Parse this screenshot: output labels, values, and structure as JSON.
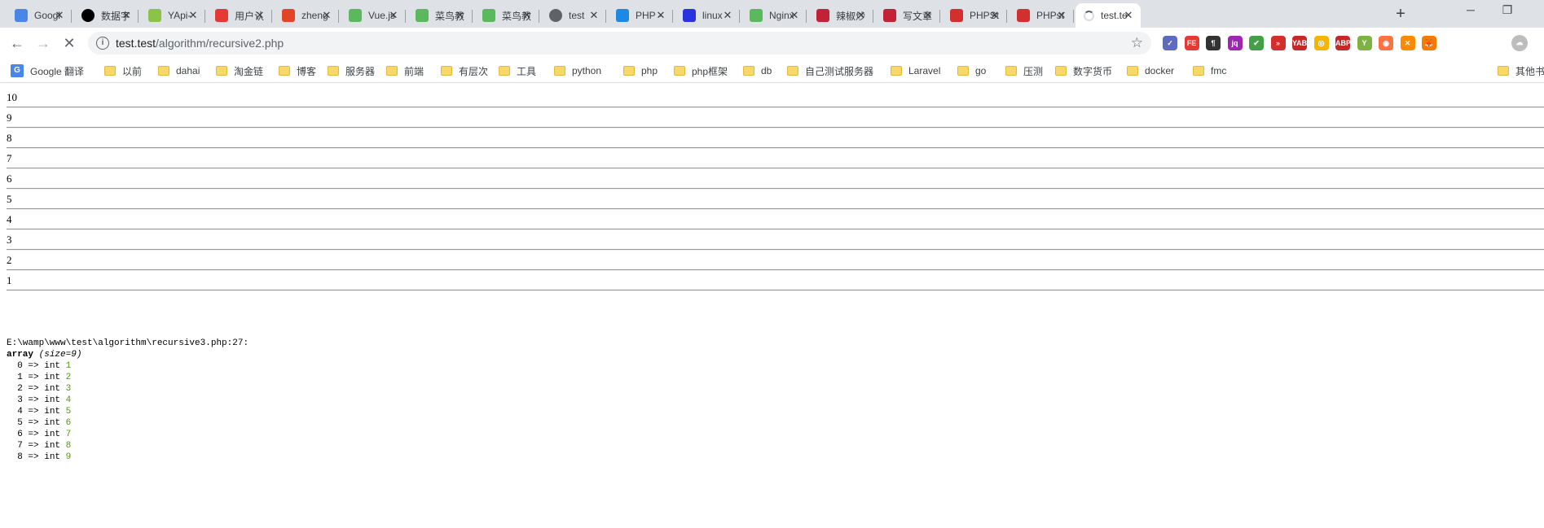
{
  "tabs": [
    {
      "title": "Googl",
      "icon": "google-translate-icon",
      "color": "#4a86e8"
    },
    {
      "title": "数据字",
      "icon": "black-circle-icon",
      "color": "#000000"
    },
    {
      "title": "YApi-",
      "icon": "yapi-icon",
      "color": "#8bc34a"
    },
    {
      "title": "用户认",
      "icon": "user-auth-icon",
      "color": "#e53935"
    },
    {
      "title": "zheng",
      "icon": "gitlab-icon",
      "color": "#e24329"
    },
    {
      "title": "Vue.js",
      "icon": "runoob-icon",
      "color": "#5cb85c"
    },
    {
      "title": "菜鸟教",
      "icon": "runoob-icon",
      "color": "#5cb85c"
    },
    {
      "title": "菜鸟教",
      "icon": "runoob-icon",
      "color": "#5cb85c"
    },
    {
      "title": "test",
      "icon": "globe-icon",
      "color": "#5f6368"
    },
    {
      "title": "PHP -",
      "icon": "php-doc-icon",
      "color": "#1e88e5"
    },
    {
      "title": "linux",
      "icon": "baidu-icon",
      "color": "#2932e1"
    },
    {
      "title": "Nginx",
      "icon": "runoob-icon",
      "color": "#5cb85c"
    },
    {
      "title": "辣椒炒",
      "icon": "csdn-icon",
      "color": "#c32136"
    },
    {
      "title": "写文章",
      "icon": "csdn-icon",
      "color": "#c32136"
    },
    {
      "title": "PHPSt",
      "icon": "php-cn-icon",
      "color": "#d32f2f"
    },
    {
      "title": "PHPst",
      "icon": "php-cn-icon",
      "color": "#d32f2f"
    },
    {
      "title": "test.te",
      "icon": "loading-spinner-icon",
      "color": "#5f6368",
      "active": true
    }
  ],
  "omnibox": {
    "host": "test.test",
    "path": "/algorithm/recursive2.php"
  },
  "bookmarks": [
    {
      "label": "Google 翻译",
      "type": "translate"
    },
    {
      "label": "以前",
      "type": "folder"
    },
    {
      "label": "dahai",
      "type": "folder"
    },
    {
      "label": "淘金链",
      "type": "folder"
    },
    {
      "label": "博客",
      "type": "folder"
    },
    {
      "label": "服务器",
      "type": "folder"
    },
    {
      "label": "前端",
      "type": "folder"
    },
    {
      "label": "有层次",
      "type": "folder"
    },
    {
      "label": "工具",
      "type": "folder"
    },
    {
      "label": "python",
      "type": "folder"
    },
    {
      "label": "php",
      "type": "folder"
    },
    {
      "label": "php框架",
      "type": "folder"
    },
    {
      "label": "db",
      "type": "folder"
    },
    {
      "label": "自己测试服务器",
      "type": "folder"
    },
    {
      "label": "Laravel",
      "type": "folder"
    },
    {
      "label": "go",
      "type": "folder"
    },
    {
      "label": "压测",
      "type": "folder"
    },
    {
      "label": "数字货币",
      "type": "folder"
    },
    {
      "label": "docker",
      "type": "folder"
    },
    {
      "label": "fmc",
      "type": "folder"
    },
    {
      "label": "其他书",
      "type": "folder"
    }
  ],
  "page": {
    "rows": [
      "10",
      "9",
      "8",
      "7",
      "6",
      "5",
      "4",
      "3",
      "2",
      "1"
    ],
    "dump": {
      "location": "E:\\wamp\\www\\test\\algorithm\\recursive3.php:27:",
      "type_word": "array",
      "size_label": "(size=9)",
      "entries": [
        {
          "key": "0",
          "type": "int",
          "value": "1"
        },
        {
          "key": "1",
          "type": "int",
          "value": "2"
        },
        {
          "key": "2",
          "type": "int",
          "value": "3"
        },
        {
          "key": "3",
          "type": "int",
          "value": "4"
        },
        {
          "key": "4",
          "type": "int",
          "value": "5"
        },
        {
          "key": "5",
          "type": "int",
          "value": "6"
        },
        {
          "key": "6",
          "type": "int",
          "value": "7"
        },
        {
          "key": "7",
          "type": "int",
          "value": "8"
        },
        {
          "key": "8",
          "type": "int",
          "value": "9"
        }
      ]
    }
  },
  "extensions": [
    {
      "name": "extension-purple-check-icon",
      "color": "#5c6bc0",
      "glyph": "✓"
    },
    {
      "name": "extension-fe-icon",
      "color": "#e53935",
      "glyph": "FE"
    },
    {
      "name": "extension-paragraph-icon",
      "color": "#333333",
      "glyph": "¶"
    },
    {
      "name": "extension-jqp-icon",
      "color": "#9c27b0",
      "glyph": "jq"
    },
    {
      "name": "extension-shield-icon",
      "color": "#43a047",
      "glyph": "✔"
    },
    {
      "name": "extension-forward-icon",
      "color": "#d32f2f",
      "glyph": "»"
    },
    {
      "name": "extension-yab-icon",
      "color": "#c62828",
      "glyph": "YAB"
    },
    {
      "name": "extension-chrome-ring-icon",
      "color": "#f4b400",
      "glyph": "◎"
    },
    {
      "name": "extension-abp-icon",
      "color": "#c62828",
      "glyph": "ABP"
    },
    {
      "name": "extension-yapi-icon",
      "color": "#7cb342",
      "glyph": "Y"
    },
    {
      "name": "extension-orange-circle-icon",
      "color": "#ff7043",
      "glyph": "◉"
    },
    {
      "name": "extension-x-icon",
      "color": "#ff8a00",
      "glyph": "✕"
    },
    {
      "name": "extension-fox-icon",
      "color": "#f57c00",
      "glyph": "🦊"
    },
    {
      "name": "profile-avatar-icon",
      "color": "#bdbdbd",
      "glyph": "☁"
    }
  ]
}
